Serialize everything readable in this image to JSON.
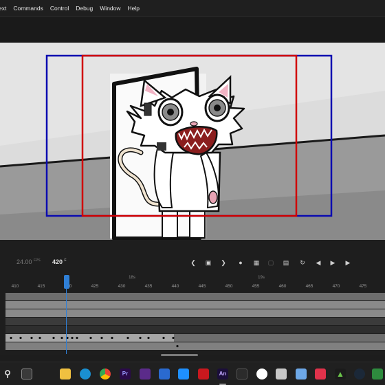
{
  "menu": [
    "ext",
    "Commands",
    "Control",
    "Debug",
    "Window",
    "Help"
  ],
  "timeline": {
    "fps_value": "24.00",
    "fps_unit": "FPS",
    "current_frame": "420",
    "frame_unit": "F",
    "ruler_ticks": [
      "410",
      "415",
      "420",
      "425",
      "430",
      "435",
      "440",
      "445",
      "450",
      "455",
      "460",
      "465",
      "470",
      "475"
    ],
    "seconds_markers": [
      "18s",
      "19s"
    ],
    "playhead_frame": 420
  },
  "taskbar": {
    "apps": [
      "search",
      "task-view",
      "file-explorer",
      "edge",
      "chrome",
      "premiere",
      "clipchamp",
      "mail",
      "adobe-red",
      "animate",
      "app-dark",
      "obs",
      "notes",
      "photos",
      "xbox",
      "steam",
      "gamebar"
    ],
    "active": "animate",
    "animate_label": "An"
  }
}
